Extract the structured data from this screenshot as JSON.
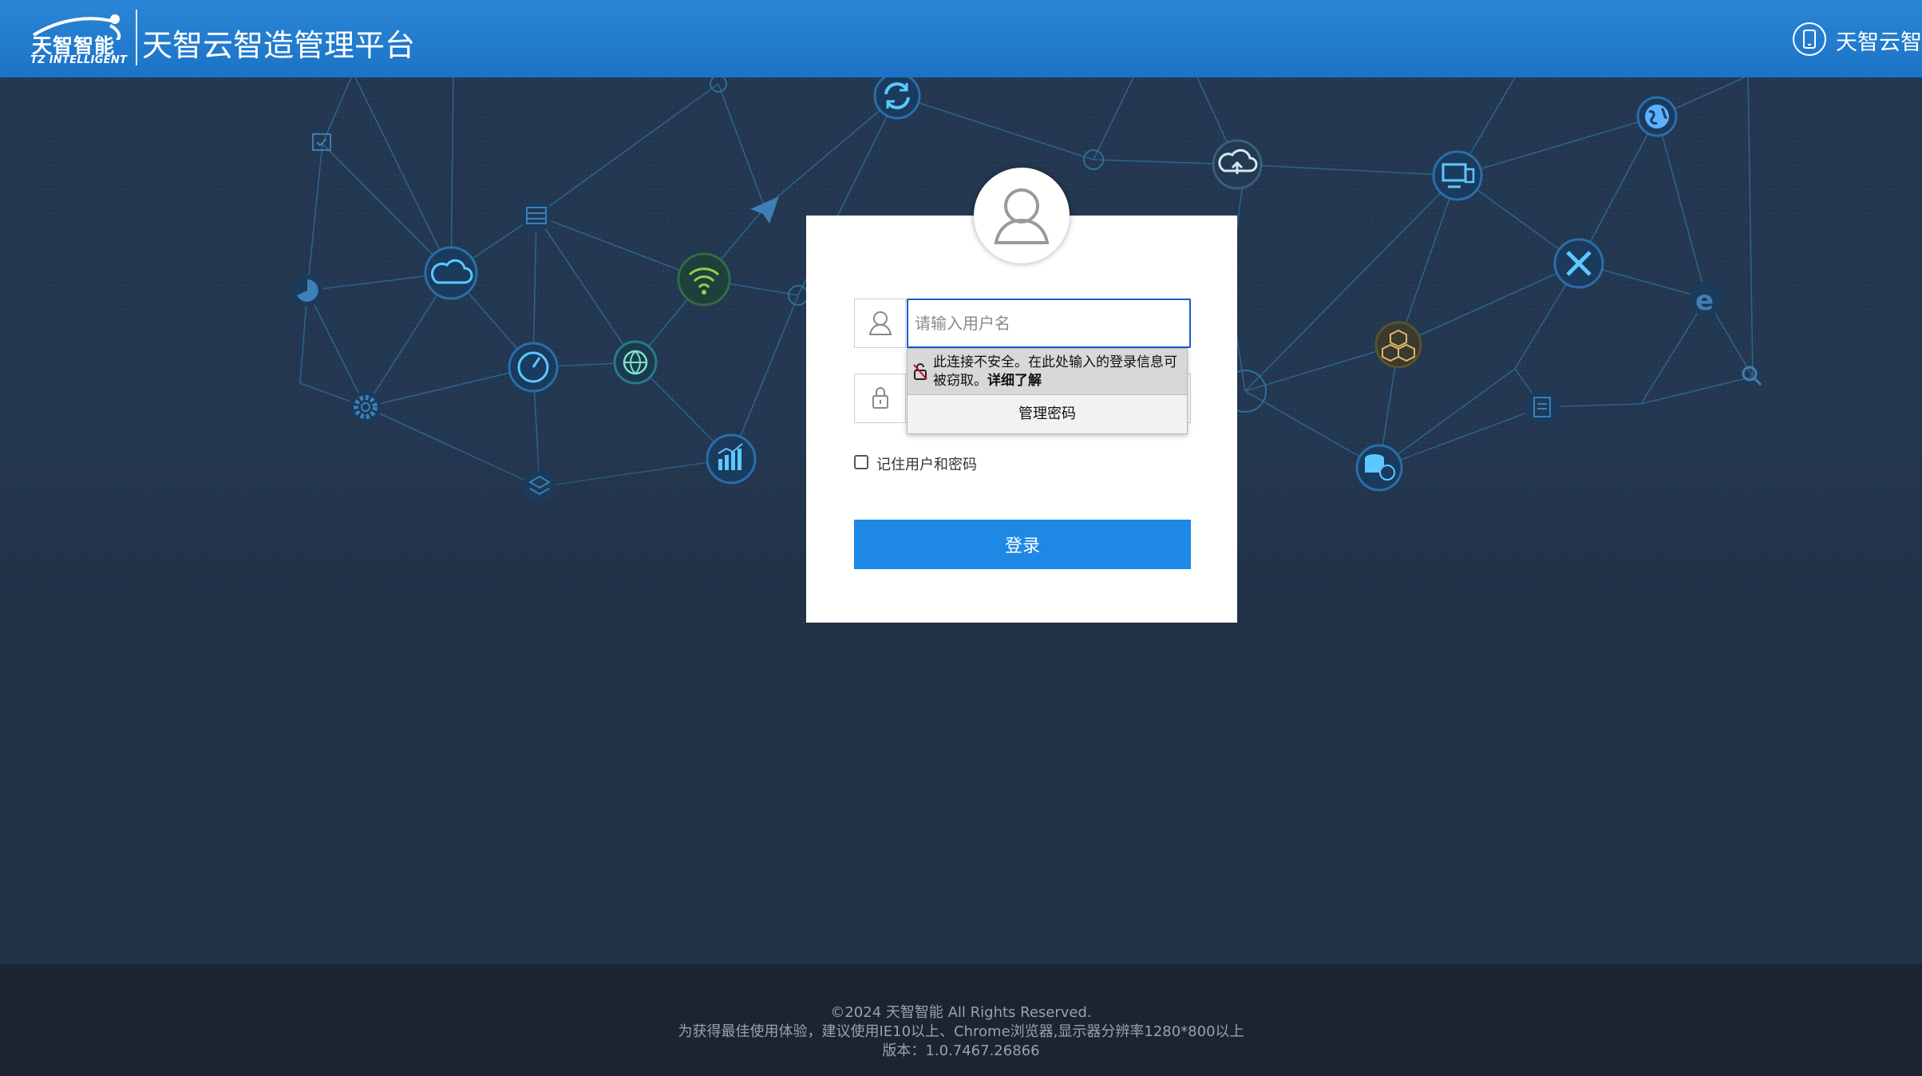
{
  "header": {
    "logo_cn": "天智智能",
    "logo_en": "TZ INTELLIGENT",
    "title": "天智云智造管理平台",
    "mobile_label": "天智云智造",
    "brand_color": "#1f7bcf"
  },
  "login": {
    "username_placeholder": "请输入用户名",
    "remember_label": "记住用户和密码",
    "submit_label": "登录",
    "button_color": "#1e88e5"
  },
  "autofill": {
    "warning_text": "此连接不安全。在此处输入的登录信息可被窃取。",
    "learn_more": "详细了解",
    "manage_passwords": "管理密码"
  },
  "footer": {
    "copyright": "©2024 天智智能 All Rights Reserved.",
    "browser_tip": "为获得最佳使用体验，建议使用IE10以上、Chrome浏览器,显示器分辨率1280*800以上",
    "version": "版本：1.0.7467.26866"
  },
  "background_icons": [
    "calendar-icon",
    "pie-chart-icon",
    "gear-icon",
    "cloud-icon",
    "database-icon",
    "speedometer-icon",
    "dropbox-icon",
    "wifi-icon",
    "globe-grid-icon",
    "send-icon",
    "bar-chart-icon",
    "sync-icon",
    "cloud-upload-icon",
    "monitor-icon",
    "earth-icon",
    "tools-icon",
    "boxes-icon",
    "coin-database-icon",
    "clipboard-icon",
    "ie-icon",
    "search-icon"
  ]
}
